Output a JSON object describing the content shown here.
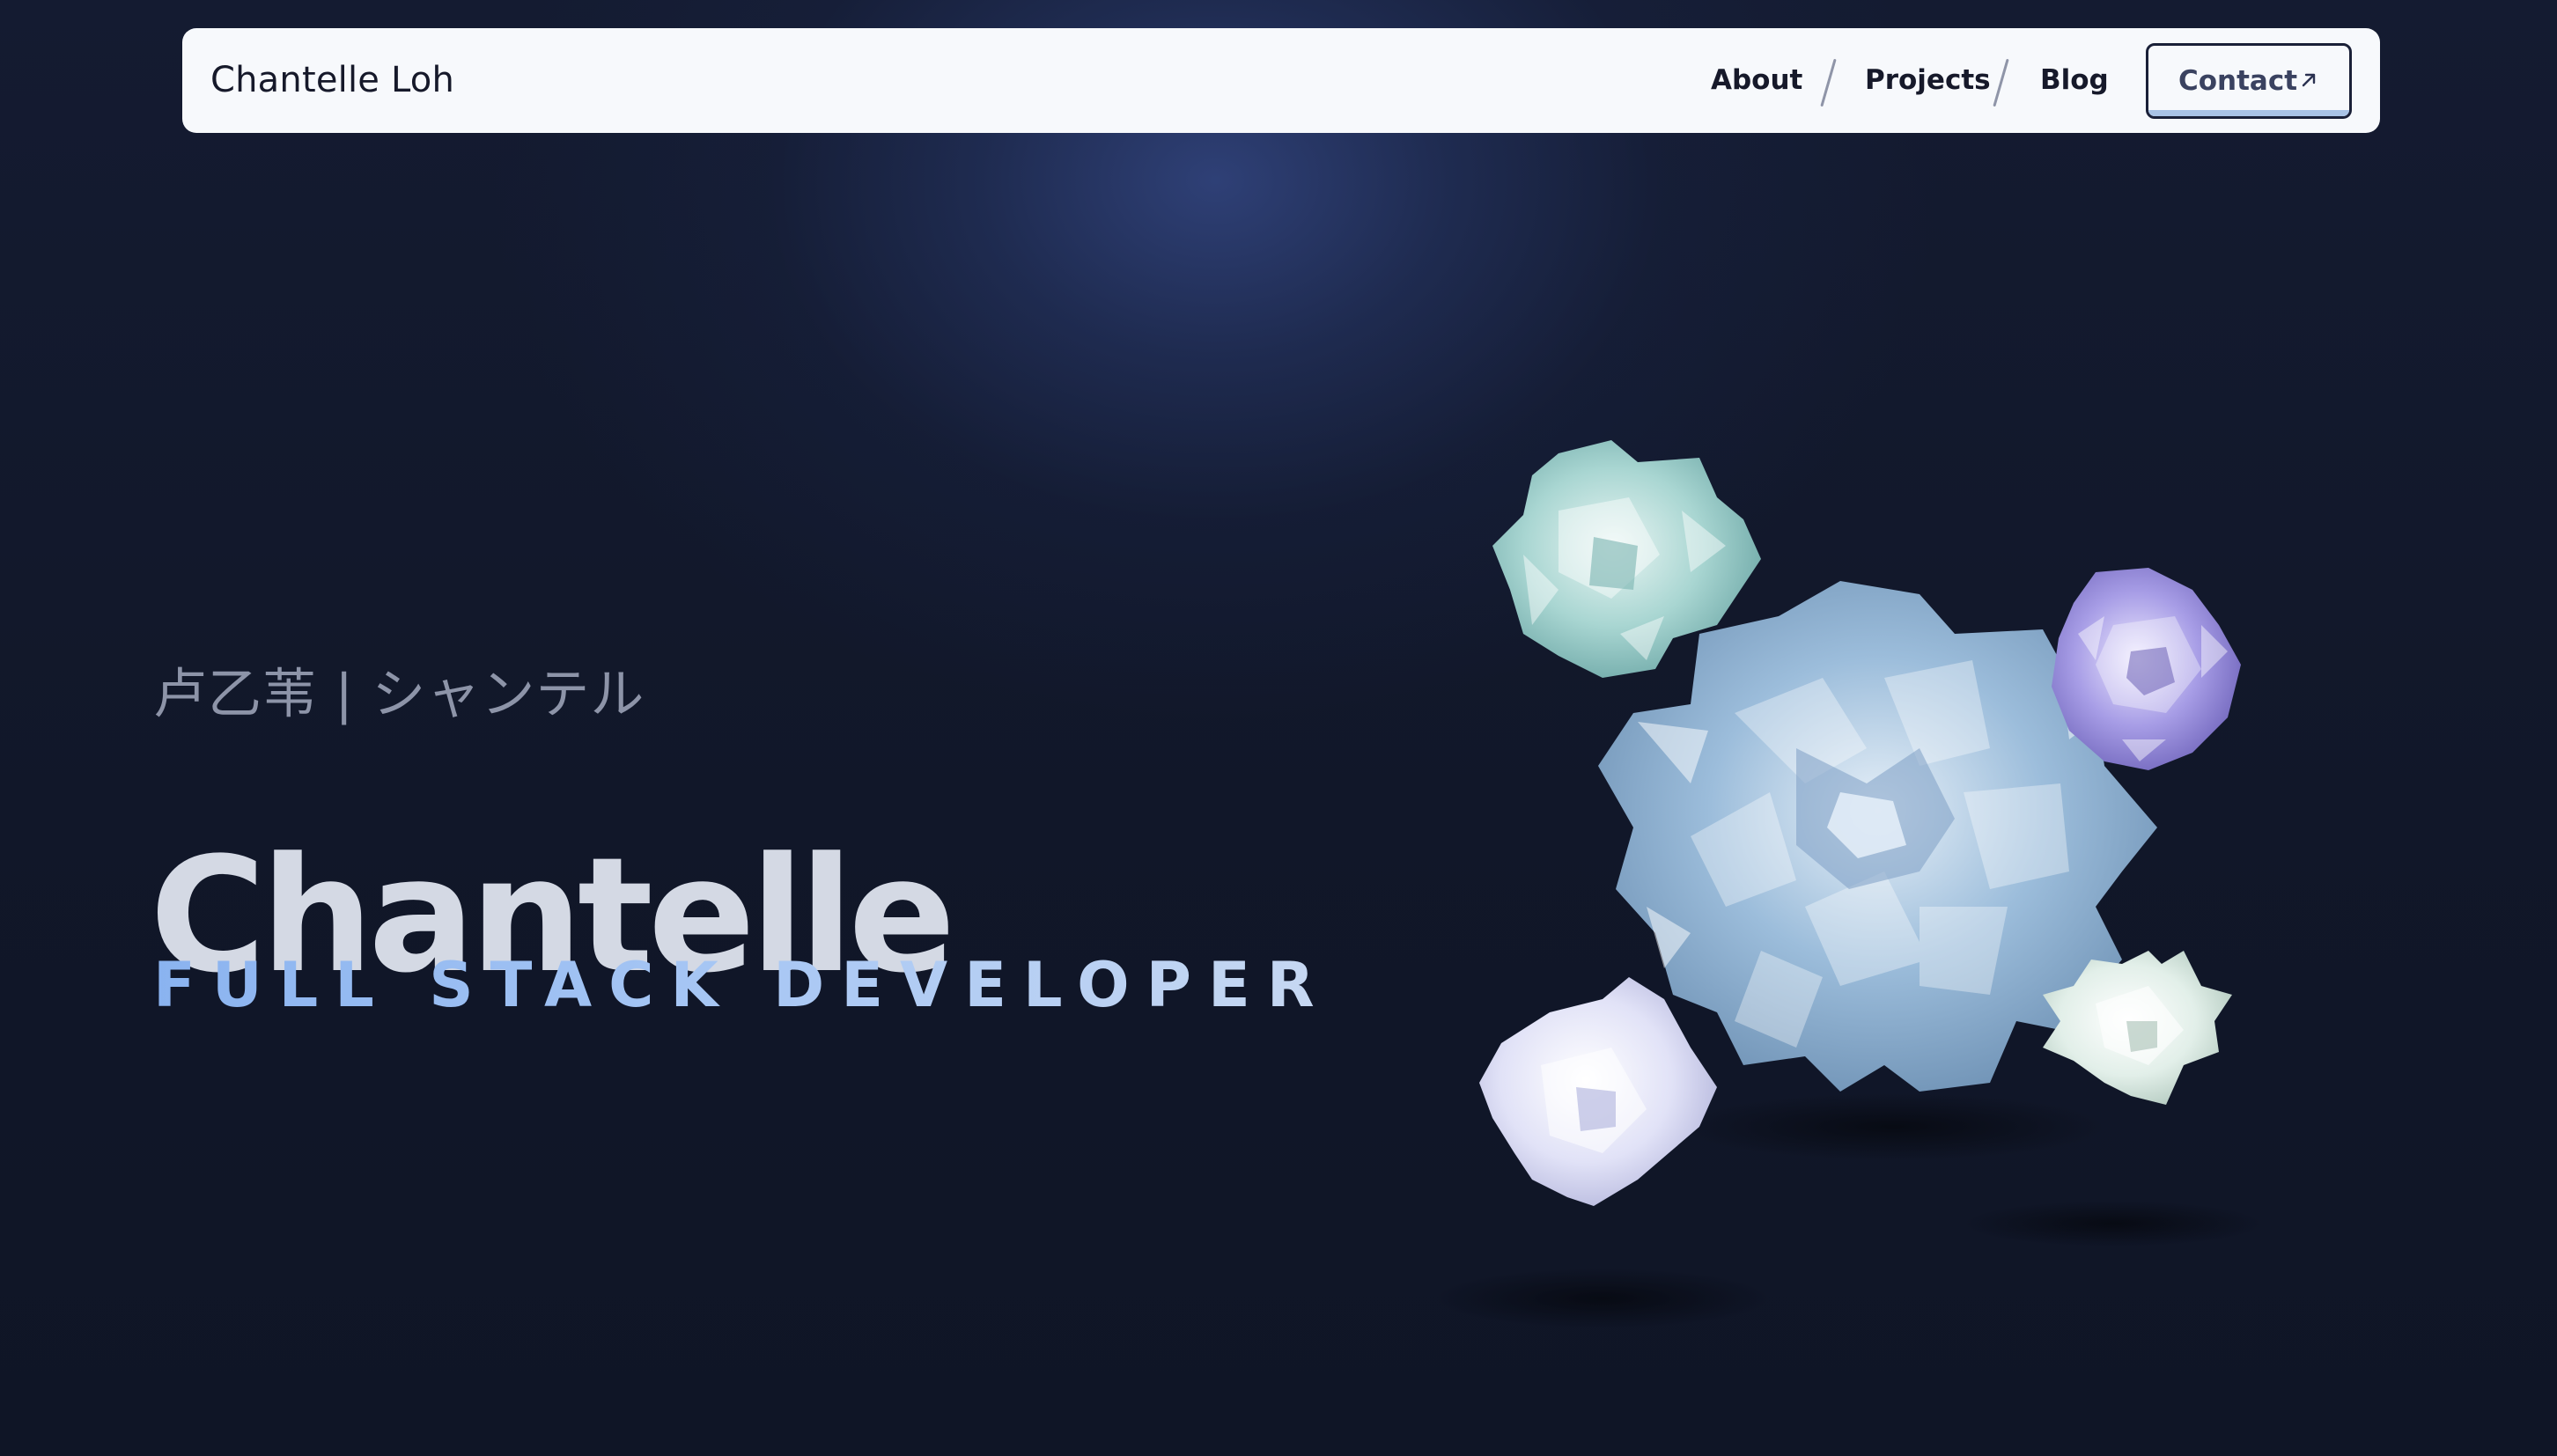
{
  "navbar": {
    "brand": "Chantelle Loh",
    "links": [
      {
        "label": "About"
      },
      {
        "label": "Projects"
      },
      {
        "label": "Blog"
      }
    ],
    "contact": {
      "label": "Contact",
      "icon": "arrow-up-right-icon"
    }
  },
  "hero": {
    "native_name": "卢乙苇 | シャンテル",
    "name": "Chantelle",
    "role": "FULL STACK DEVELOPER"
  },
  "flowers": {
    "items": [
      {
        "name": "teal-rose",
        "color": "#a9d6d2"
      },
      {
        "name": "blue-succulent",
        "color": "#9cbddb"
      },
      {
        "name": "lavender-rose",
        "color": "#a79de6"
      },
      {
        "name": "white-rose",
        "color": "#e1e2f7"
      },
      {
        "name": "mint-bloom",
        "color": "#e2efe9"
      }
    ]
  },
  "colors": {
    "background": "#111729",
    "navbar_bg": "#f7f9fc",
    "accent": "#a8c7f4",
    "name_text": "#d4d9e4"
  }
}
